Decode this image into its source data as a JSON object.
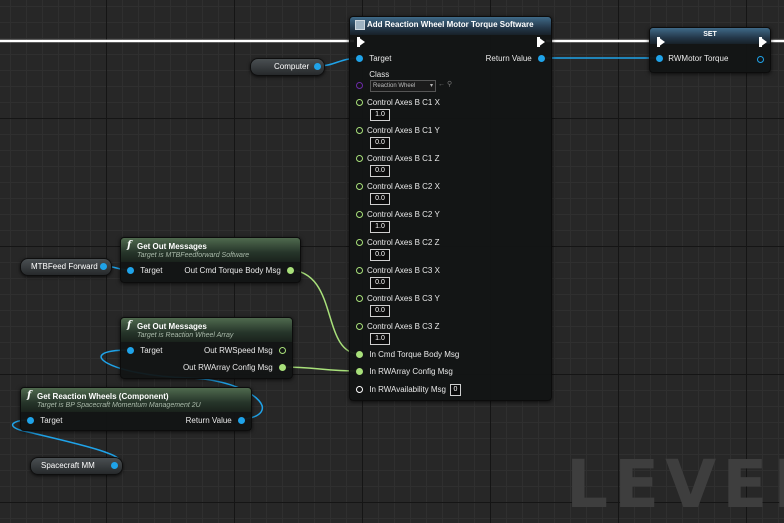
{
  "watermark": "LEVEL",
  "main_node": {
    "title": "Add Reaction Wheel Motor Torque Software",
    "target_label": "Target",
    "return_label": "Return Value",
    "class_label": "Class",
    "class_value": "Reaction Wheel",
    "control_axes": [
      {
        "label": "Control Axes B C1 X",
        "value": "1.0"
      },
      {
        "label": "Control Axes B C1 Y",
        "value": "0.0"
      },
      {
        "label": "Control Axes B C1 Z",
        "value": "0.0"
      },
      {
        "label": "Control Axes B C2 X",
        "value": "0.0"
      },
      {
        "label": "Control Axes B C2 Y",
        "value": "1.0"
      },
      {
        "label": "Control Axes B C2 Z",
        "value": "0.0"
      },
      {
        "label": "Control Axes B C3 X",
        "value": "0.0"
      },
      {
        "label": "Control Axes B C3 Y",
        "value": "0.0"
      },
      {
        "label": "Control Axes B C3 Z",
        "value": "1.0"
      }
    ],
    "in_cmd_label": "In Cmd Torque Body Msg",
    "in_rwarray_label": "In RWArray Config Msg",
    "in_rwavail_label": "In RWAvailability Msg",
    "in_rwavail_value": "0"
  },
  "set_node": {
    "title": "SET",
    "var_label": "RWMotor Torque"
  },
  "computer_node": {
    "label": "Computer"
  },
  "mtbfeed_node": {
    "label": "MTBFeed Forward"
  },
  "spacecraft_node": {
    "label": "Spacecraft MM"
  },
  "get_out_1": {
    "title": "Get Out Messages",
    "subtitle": "Target is MTBFeedforward Software",
    "target_label": "Target",
    "out_label": "Out Cmd Torque Body Msg"
  },
  "get_out_2": {
    "title": "Get Out Messages",
    "subtitle": "Target is Reaction Wheel Array",
    "target_label": "Target",
    "out_speed_label": "Out RWSpeed Msg",
    "out_config_label": "Out RWArray Config Msg"
  },
  "get_rw": {
    "title": "Get Reaction Wheels (Component)",
    "subtitle": "Target is BP Spacecraft Momentum Management 2U",
    "target_label": "Target",
    "return_label": "Return Value"
  },
  "colors": {
    "object_pin": "#1fa3e9",
    "struct_pin": "#a8e07a",
    "exec": "#ffffff",
    "class_pin": "#6c2aa8"
  }
}
